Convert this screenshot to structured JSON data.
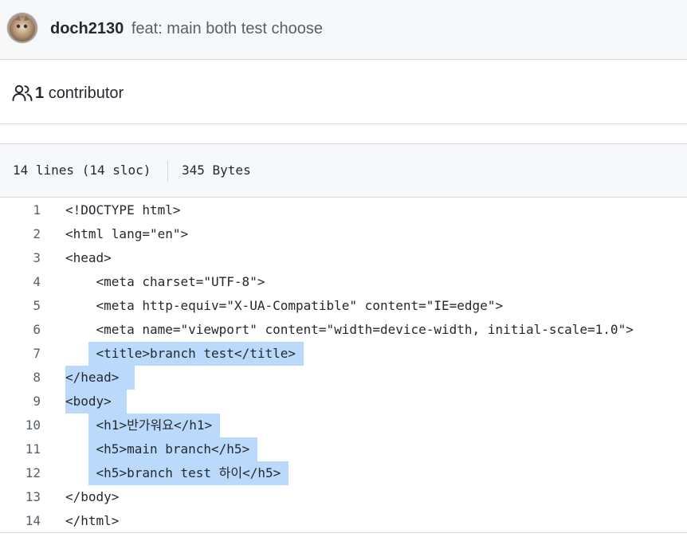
{
  "commit": {
    "author": "doch2130",
    "message": "feat: main both test choose"
  },
  "contributors": {
    "icon": "people-icon",
    "count": "1",
    "label": "contributor"
  },
  "file": {
    "lines": "14 lines (14 sloc)",
    "size": "345 Bytes"
  },
  "code": {
    "lines": [
      {
        "num": "1",
        "text": "<!DOCTYPE html>"
      },
      {
        "num": "2",
        "text": "<html lang=\"en\">"
      },
      {
        "num": "3",
        "text": "<head>"
      },
      {
        "num": "4",
        "text": "    <meta charset=\"UTF-8\">"
      },
      {
        "num": "5",
        "text": "    <meta http-equiv=\"X-UA-Compatible\" content=\"IE=edge\">"
      },
      {
        "num": "6",
        "text": "    <meta name=\"viewport\" content=\"width=device-width, initial-scale=1.0\">"
      },
      {
        "num": "7",
        "text": "    <title>branch test</title>"
      },
      {
        "num": "8",
        "text": "</head>"
      },
      {
        "num": "9",
        "text": "<body>"
      },
      {
        "num": "10",
        "text": "    <h1>반가워요</h1>"
      },
      {
        "num": "11",
        "text": "    <h5>main branch</h5>"
      },
      {
        "num": "12",
        "text": "    <h5>branch test 하이</h5>"
      },
      {
        "num": "13",
        "text": "</body>"
      },
      {
        "num": "14",
        "text": "</html>"
      }
    ]
  }
}
